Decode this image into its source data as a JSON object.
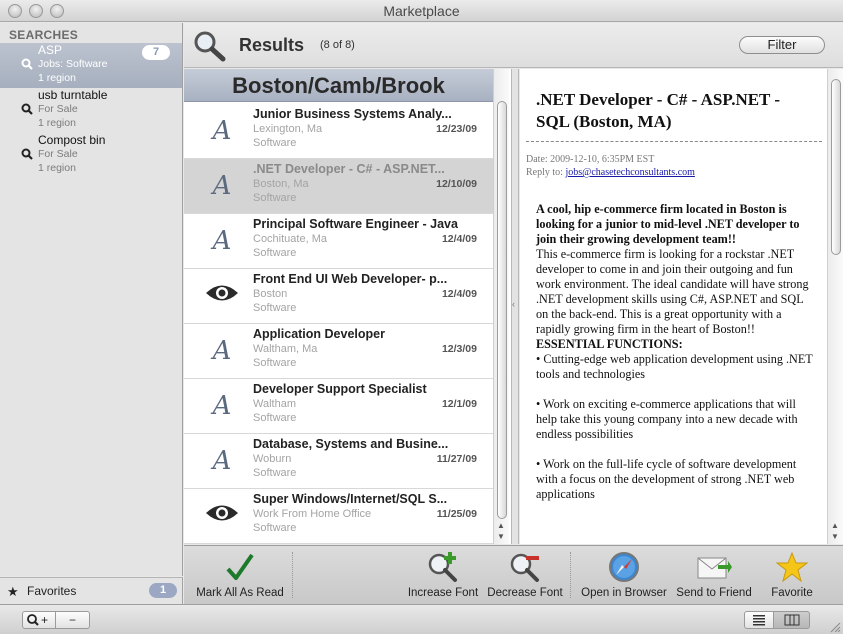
{
  "window": {
    "title": "Marketplace"
  },
  "sidebar": {
    "header": "SEARCHES",
    "items": [
      {
        "title": "ASP",
        "category": "Jobs: Software",
        "regions": "1 region",
        "count": "7",
        "selected": true
      },
      {
        "title": "usb turntable",
        "category": "For Sale",
        "regions": "1 region"
      },
      {
        "title": "Compost bin",
        "category": "For Sale",
        "regions": "1 region"
      }
    ],
    "favorites": {
      "label": "Favorites",
      "count": "1"
    }
  },
  "bottombar": {
    "add_label": "+",
    "remove_label": "−"
  },
  "header": {
    "title": "Results",
    "count": "(8 of 8)",
    "filter_label": "Filter"
  },
  "list": {
    "region": "Boston/Camb/Brook",
    "rows": [
      {
        "icon": "font-icon",
        "title": "Junior Business Systems Analy...",
        "location": "Lexington, Ma",
        "category": "Software",
        "date": "12/23/09"
      },
      {
        "icon": "font-icon",
        "title": ".NET Developer - C# - ASP.NET...",
        "location": "Boston, Ma",
        "category": "Software",
        "date": "12/10/09",
        "selected": true
      },
      {
        "icon": "font-icon",
        "title": "Principal Software Engineer - Java",
        "location": "Cochituate, Ma",
        "category": "Software",
        "date": "12/4/09"
      },
      {
        "icon": "eye-icon",
        "title": "Front End UI Web Developer- p...",
        "location": "Boston",
        "category": "Software",
        "date": "12/4/09"
      },
      {
        "icon": "font-icon",
        "title": "Application Developer",
        "location": "Waltham, Ma",
        "category": "Software",
        "date": "12/3/09"
      },
      {
        "icon": "font-icon",
        "title": "Developer Support Specialist",
        "location": "Waltham",
        "category": "Software",
        "date": "12/1/09"
      },
      {
        "icon": "font-icon",
        "title": "Database, Systems and Busine...",
        "location": "Woburn",
        "category": "Software",
        "date": "11/27/09"
      },
      {
        "icon": "eye-icon",
        "title": "Super Windows/Internet/SQL S...",
        "location": "Work From Home Office",
        "category": "Software",
        "date": "11/25/09"
      }
    ]
  },
  "detail": {
    "title": ".NET Developer - C# - ASP.NET - SQL (Boston, MA)",
    "date": "Date: 2009-12-10, 6:35PM EST",
    "reply_label": "Reply to: ",
    "reply_email": "jobs@chasetechconsultants.com",
    "intro_bold": "A cool, hip e-commerce firm located in Boston is looking for a junior to mid-level .NET developer to join their growing development team!!",
    "intro": "This e-commerce firm is looking for a rockstar .NET developer to come in and join their outgoing and fun work environment. The ideal candidate will have strong .NET development skills using C#, ASP.NET and SQL on the back-end. This is a great opportunity with a rapidly growing firm in the heart of Boston!!",
    "section_title": "ESSENTIAL FUNCTIONS:",
    "bullets": [
      "Cutting-edge web application development using .NET tools and technologies",
      "Work on exciting e-commerce applications that will help take this young company into a new decade with endless possibilities",
      "Work on the full-life cycle of software development with a focus on the development of strong .NET web applications"
    ]
  },
  "toolbar": {
    "mark_all_read": "Mark All As Read",
    "increase_font": "Increase Font",
    "decrease_font": "Decrease Font",
    "open_browser": "Open in Browser",
    "send_friend": "Send to Friend",
    "favorite": "Favorite"
  }
}
